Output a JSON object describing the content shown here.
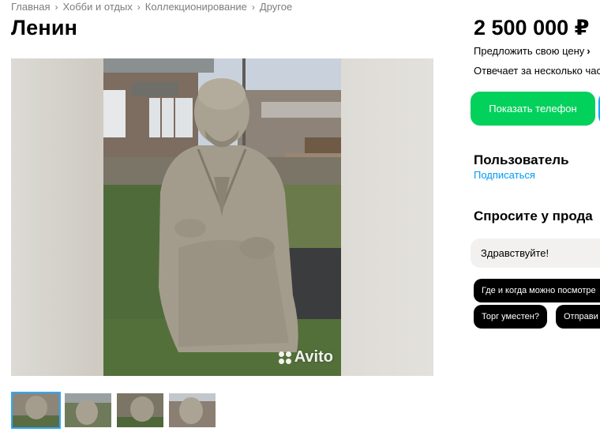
{
  "breadcrumb": [
    "Главная",
    "Хобби и отдых",
    "Коллекционирование",
    "Другое"
  ],
  "listing": {
    "title": "Ленин",
    "watermark": "Avito"
  },
  "sidebar": {
    "price": "2 500 000 ₽",
    "offer_label": "Предложить свою цену",
    "offer_chevron": "›",
    "responds": "Отвечает за несколько час",
    "show_phone_label": "Показать телефон",
    "seller_name": "Пользователь",
    "subscribe_label": "Подписаться",
    "ask_title": "Спросите у прода",
    "message_value": "Здравствуйте!",
    "chips": [
      "Где и когда можно посмотре",
      "Торг уместен?",
      "Отправи"
    ]
  },
  "colors": {
    "accent_green": "#02d15c",
    "accent_blue": "#00aaff",
    "link_blue": "#0099f7",
    "thumb_selected": "#2ea8ff"
  }
}
